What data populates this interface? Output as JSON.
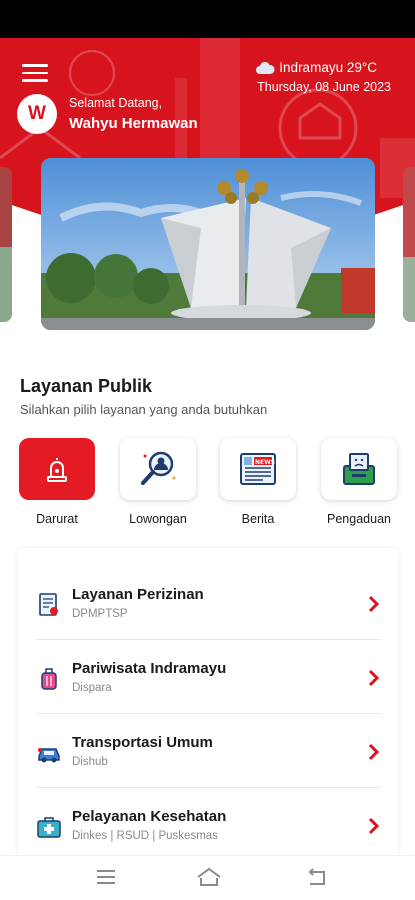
{
  "header": {
    "greeting": "Selamat Datang,",
    "username": "Wahyu Hermawan",
    "avatar_initial": "W",
    "weather": "Indramayu 29°C",
    "date": "Thursday, 08 June 2023"
  },
  "section": {
    "title": "Layanan Publik",
    "subtitle": "Silahkan pilih layanan yang anda butuhkan"
  },
  "services": [
    {
      "label": "Darurat",
      "icon": "siren-icon"
    },
    {
      "label": "Lowongan",
      "icon": "job-search-icon"
    },
    {
      "label": "Berita",
      "icon": "newspaper-icon"
    },
    {
      "label": "Pengaduan",
      "icon": "complaint-box-icon"
    }
  ],
  "list": [
    {
      "title": "Layanan Perizinan",
      "subtitle": "DPMPTSP",
      "icon": "document-permit-icon"
    },
    {
      "title": "Pariwisata Indramayu",
      "subtitle": "Dispara",
      "icon": "luggage-icon"
    },
    {
      "title": "Transportasi Umum",
      "subtitle": "Dishub",
      "icon": "car-icon"
    },
    {
      "title": "Pelayanan Kesehatan",
      "subtitle": "Dinkes | RSUD | Puskesmas",
      "icon": "medical-kit-icon"
    }
  ],
  "colors": {
    "brand_red": "#d7141e",
    "active_red": "#e41b23",
    "chevron_red": "#d7141e"
  }
}
